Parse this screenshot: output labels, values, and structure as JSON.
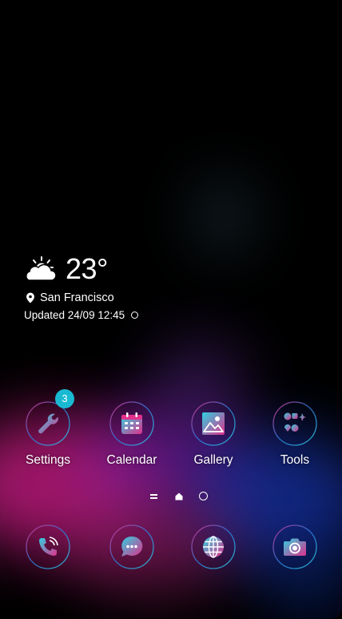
{
  "weather": {
    "condition_icon": "partly-cloudy-icon",
    "temperature": "23°",
    "location": "San Francisco",
    "updated": "Updated 24/09 12:45"
  },
  "apps": [
    {
      "label": "Settings",
      "icon": "wrench-icon",
      "badge": "3"
    },
    {
      "label": "Calendar",
      "icon": "calendar-icon"
    },
    {
      "label": "Gallery",
      "icon": "gallery-icon"
    },
    {
      "label": "Tools",
      "icon": "tools-folder-icon"
    }
  ],
  "dock": [
    {
      "icon": "phone-icon"
    },
    {
      "icon": "messages-icon"
    },
    {
      "icon": "browser-globe-icon"
    },
    {
      "icon": "camera-icon"
    }
  ],
  "colors": {
    "accent_pink": "#e0308c",
    "accent_cyan": "#2fd0e0",
    "badge": "#19b9d2"
  }
}
